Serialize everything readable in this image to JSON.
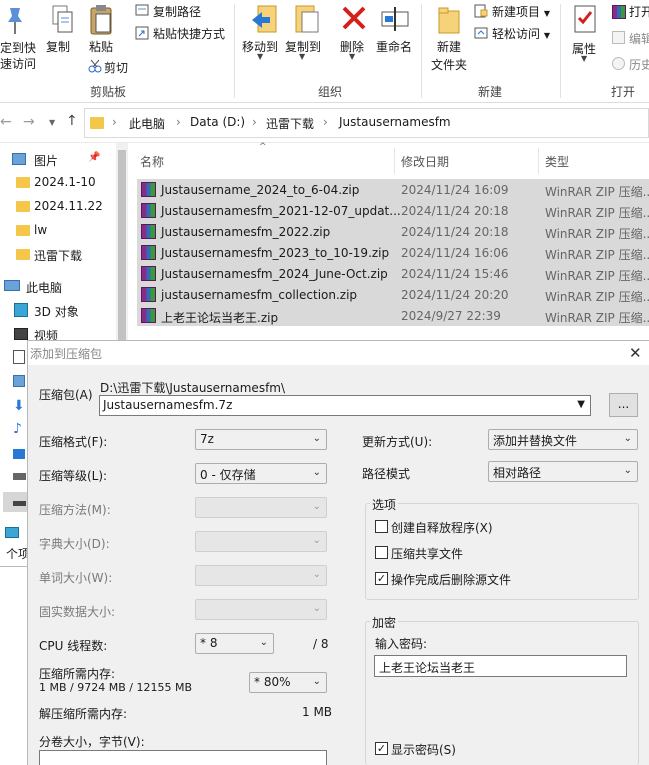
{
  "ribbon": {
    "pin_quick_access": [
      "定到快",
      "速访问"
    ],
    "copy": "复制",
    "paste": "粘贴",
    "copy_path": "复制路径",
    "paste_shortcut": "粘贴快捷方式",
    "cut": "剪切",
    "clipboard_group": "剪贴板",
    "move_to": "移动到",
    "copy_to": "复制到",
    "delete": "删除",
    "rename": "重命名",
    "organize_group": "组织",
    "new_folder": [
      "新建",
      "文件夹"
    ],
    "new_item": "新建项目",
    "easy_access": "轻松访问",
    "new_group": "新建",
    "properties": "属性",
    "open": "打开",
    "edit": "编辑",
    "history": "历史",
    "open_group": "打开"
  },
  "address": {
    "crumbs": [
      "此电脑",
      "Data (D:)",
      "迅雷下载",
      "Justausernamesfm"
    ]
  },
  "nav": {
    "items": [
      "图片",
      "2024.1-10",
      "2024.11.22",
      "lw",
      "迅雷下载",
      "此电脑",
      "3D 对象",
      "视频"
    ],
    "count_label": "个项"
  },
  "files": {
    "columns": [
      "名称",
      "修改日期",
      "类型"
    ],
    "rows": [
      {
        "name": "Justausername_2024_to_6-04.zip",
        "date": "2024/11/24 16:09",
        "type": "WinRAR ZIP 压缩..."
      },
      {
        "name": "Justausernamesfm_2021-12-07_updat...",
        "date": "2024/11/24 20:18",
        "type": "WinRAR ZIP 压缩..."
      },
      {
        "name": "Justausernamesfm_2022.zip",
        "date": "2024/11/24 20:18",
        "type": "WinRAR ZIP 压缩..."
      },
      {
        "name": "Justausernamesfm_2023_to_10-19.zip",
        "date": "2024/11/24 16:06",
        "type": "WinRAR ZIP 压缩..."
      },
      {
        "name": "Justausernamesfm_2024_June-Oct.zip",
        "date": "2024/11/24 15:46",
        "type": "WinRAR ZIP 压缩..."
      },
      {
        "name": "justausernamesfm_collection.zip",
        "date": "2024/11/24 20:20",
        "type": "WinRAR ZIP 压缩..."
      },
      {
        "name": "上老王论坛当老王.zip",
        "date": "2024/9/27 22:39",
        "type": "WinRAR ZIP 压缩..."
      }
    ]
  },
  "dialog": {
    "title": "添加到压缩包",
    "archive_label": "压缩包(A)",
    "archive_path": "D:\\迅雷下载\\Justausernamesfm\\",
    "archive_name": "Justausernamesfm.7z",
    "browse": "...",
    "format_label": "压缩格式(F):",
    "format_value": "7z",
    "level_label": "压缩等级(L):",
    "level_value": "0 - 仅存储",
    "method_label": "压缩方法(M):",
    "dict_label": "字典大小(D):",
    "word_label": "单词大小(W):",
    "solid_label": "固实数据大小:",
    "cpu_label": "CPU 线程数:",
    "cpu_value": "* 8",
    "cpu_max": "/ 8",
    "mem_label": "压缩所需内存:",
    "mem_values": "1 MB / 9724 MB / 12155 MB",
    "mem_pct": "* 80%",
    "decomp_label": "解压缩所需内存:",
    "decomp_value": "1 MB",
    "split_label": "分卷大小，字节(V):",
    "update_label": "更新方式(U):",
    "update_value": "添加并替换文件",
    "path_label": "路径模式",
    "path_value": "相对路径",
    "options_title": "选项",
    "opt_sfx": "创建自释放程序(X)",
    "opt_shared": "压缩共享文件",
    "opt_delete": "操作完成后删除源文件",
    "enc_title": "加密",
    "pwd_label": "输入密码:",
    "pwd_value": "上老王论坛当老王",
    "show_pwd": "显示密码(S)"
  },
  "colors": {
    "selection": "#d9d9d9",
    "folder": "#f4c64a",
    "accent": "#0078d7"
  }
}
